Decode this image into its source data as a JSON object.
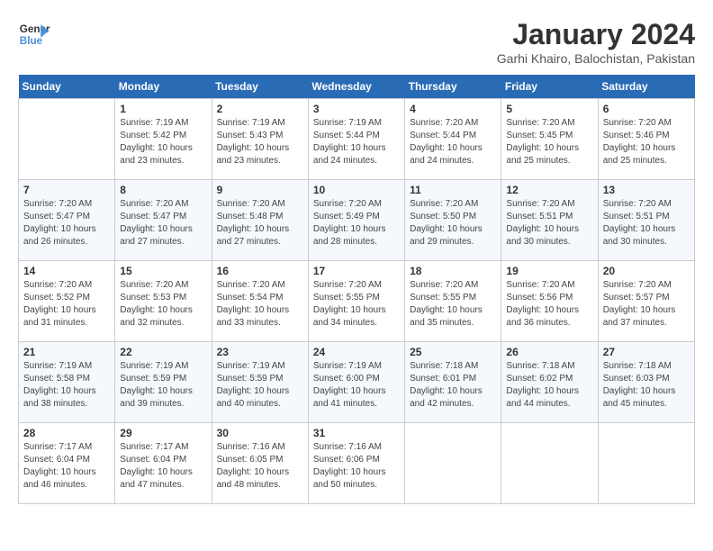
{
  "header": {
    "logo_line1": "General",
    "logo_line2": "Blue",
    "title": "January 2024",
    "subtitle": "Garhi Khairo, Balochistan, Pakistan"
  },
  "days_of_week": [
    "Sunday",
    "Monday",
    "Tuesday",
    "Wednesday",
    "Thursday",
    "Friday",
    "Saturday"
  ],
  "weeks": [
    [
      {
        "day": "",
        "sunrise": "",
        "sunset": "",
        "daylight": ""
      },
      {
        "day": "1",
        "sunrise": "7:19 AM",
        "sunset": "5:42 PM",
        "daylight": "10 hours and 23 minutes."
      },
      {
        "day": "2",
        "sunrise": "7:19 AM",
        "sunset": "5:43 PM",
        "daylight": "10 hours and 23 minutes."
      },
      {
        "day": "3",
        "sunrise": "7:19 AM",
        "sunset": "5:44 PM",
        "daylight": "10 hours and 24 minutes."
      },
      {
        "day": "4",
        "sunrise": "7:20 AM",
        "sunset": "5:44 PM",
        "daylight": "10 hours and 24 minutes."
      },
      {
        "day": "5",
        "sunrise": "7:20 AM",
        "sunset": "5:45 PM",
        "daylight": "10 hours and 25 minutes."
      },
      {
        "day": "6",
        "sunrise": "7:20 AM",
        "sunset": "5:46 PM",
        "daylight": "10 hours and 25 minutes."
      }
    ],
    [
      {
        "day": "7",
        "sunrise": "7:20 AM",
        "sunset": "5:47 PM",
        "daylight": "10 hours and 26 minutes."
      },
      {
        "day": "8",
        "sunrise": "7:20 AM",
        "sunset": "5:47 PM",
        "daylight": "10 hours and 27 minutes."
      },
      {
        "day": "9",
        "sunrise": "7:20 AM",
        "sunset": "5:48 PM",
        "daylight": "10 hours and 27 minutes."
      },
      {
        "day": "10",
        "sunrise": "7:20 AM",
        "sunset": "5:49 PM",
        "daylight": "10 hours and 28 minutes."
      },
      {
        "day": "11",
        "sunrise": "7:20 AM",
        "sunset": "5:50 PM",
        "daylight": "10 hours and 29 minutes."
      },
      {
        "day": "12",
        "sunrise": "7:20 AM",
        "sunset": "5:51 PM",
        "daylight": "10 hours and 30 minutes."
      },
      {
        "day": "13",
        "sunrise": "7:20 AM",
        "sunset": "5:51 PM",
        "daylight": "10 hours and 30 minutes."
      }
    ],
    [
      {
        "day": "14",
        "sunrise": "7:20 AM",
        "sunset": "5:52 PM",
        "daylight": "10 hours and 31 minutes."
      },
      {
        "day": "15",
        "sunrise": "7:20 AM",
        "sunset": "5:53 PM",
        "daylight": "10 hours and 32 minutes."
      },
      {
        "day": "16",
        "sunrise": "7:20 AM",
        "sunset": "5:54 PM",
        "daylight": "10 hours and 33 minutes."
      },
      {
        "day": "17",
        "sunrise": "7:20 AM",
        "sunset": "5:55 PM",
        "daylight": "10 hours and 34 minutes."
      },
      {
        "day": "18",
        "sunrise": "7:20 AM",
        "sunset": "5:55 PM",
        "daylight": "10 hours and 35 minutes."
      },
      {
        "day": "19",
        "sunrise": "7:20 AM",
        "sunset": "5:56 PM",
        "daylight": "10 hours and 36 minutes."
      },
      {
        "day": "20",
        "sunrise": "7:20 AM",
        "sunset": "5:57 PM",
        "daylight": "10 hours and 37 minutes."
      }
    ],
    [
      {
        "day": "21",
        "sunrise": "7:19 AM",
        "sunset": "5:58 PM",
        "daylight": "10 hours and 38 minutes."
      },
      {
        "day": "22",
        "sunrise": "7:19 AM",
        "sunset": "5:59 PM",
        "daylight": "10 hours and 39 minutes."
      },
      {
        "day": "23",
        "sunrise": "7:19 AM",
        "sunset": "5:59 PM",
        "daylight": "10 hours and 40 minutes."
      },
      {
        "day": "24",
        "sunrise": "7:19 AM",
        "sunset": "6:00 PM",
        "daylight": "10 hours and 41 minutes."
      },
      {
        "day": "25",
        "sunrise": "7:18 AM",
        "sunset": "6:01 PM",
        "daylight": "10 hours and 42 minutes."
      },
      {
        "day": "26",
        "sunrise": "7:18 AM",
        "sunset": "6:02 PM",
        "daylight": "10 hours and 44 minutes."
      },
      {
        "day": "27",
        "sunrise": "7:18 AM",
        "sunset": "6:03 PM",
        "daylight": "10 hours and 45 minutes."
      }
    ],
    [
      {
        "day": "28",
        "sunrise": "7:17 AM",
        "sunset": "6:04 PM",
        "daylight": "10 hours and 46 minutes."
      },
      {
        "day": "29",
        "sunrise": "7:17 AM",
        "sunset": "6:04 PM",
        "daylight": "10 hours and 47 minutes."
      },
      {
        "day": "30",
        "sunrise": "7:16 AM",
        "sunset": "6:05 PM",
        "daylight": "10 hours and 48 minutes."
      },
      {
        "day": "31",
        "sunrise": "7:16 AM",
        "sunset": "6:06 PM",
        "daylight": "10 hours and 50 minutes."
      },
      {
        "day": "",
        "sunrise": "",
        "sunset": "",
        "daylight": ""
      },
      {
        "day": "",
        "sunrise": "",
        "sunset": "",
        "daylight": ""
      },
      {
        "day": "",
        "sunrise": "",
        "sunset": "",
        "daylight": ""
      }
    ]
  ]
}
